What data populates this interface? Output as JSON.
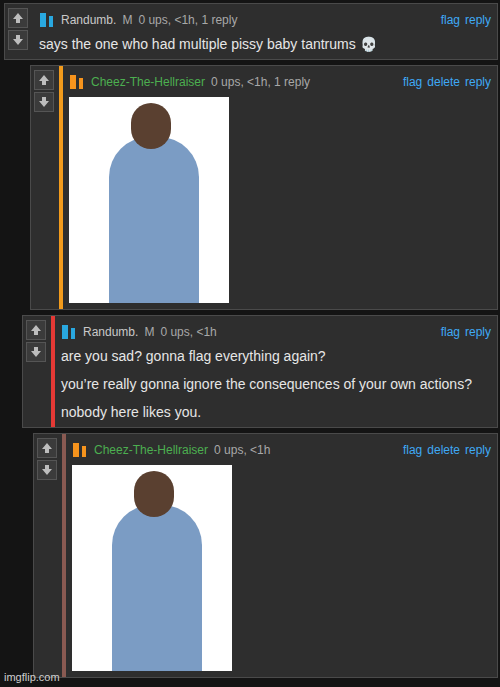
{
  "comments": [
    {
      "user": "Randumb.",
      "user_color": "#c9c9c9",
      "flag_color": "#29a8e0",
      "badge": "M",
      "meta": "0 ups, <1h, 1 reply",
      "actions": [
        "flag",
        "reply"
      ],
      "kind": "text",
      "paragraphs": [
        "says the one who had multiple pissy baby tantrums 💀"
      ],
      "color": null
    },
    {
      "user": "Cheez-The-Hellraiser",
      "user_color": "#4caf50",
      "flag_color": "#f7941d",
      "badge": "",
      "meta": "0 ups, <1h, 1 reply",
      "actions": [
        "flag",
        "delete",
        "reply"
      ],
      "kind": "image",
      "paragraphs": [],
      "color": "#f29b1c"
    },
    {
      "user": "Randumb.",
      "user_color": "#c9c9c9",
      "flag_color": "#29a8e0",
      "badge": "M",
      "meta": "0 ups, <1h",
      "actions": [
        "flag",
        "reply"
      ],
      "kind": "text",
      "paragraphs": [
        "are you sad? gonna flag everything again?",
        "you’re really gonna ignore the consequences of your own actions?",
        "nobody here likes you."
      ],
      "color": "#e53935"
    },
    {
      "user": "Cheez-The-Hellraiser",
      "user_color": "#4caf50",
      "flag_color": "#f7941d",
      "badge": "",
      "meta": "0 ups, <1h",
      "actions": [
        "flag",
        "delete",
        "reply"
      ],
      "kind": "image",
      "paragraphs": [],
      "color": "#8a5a52"
    }
  ],
  "watermark": "imgflip.com"
}
